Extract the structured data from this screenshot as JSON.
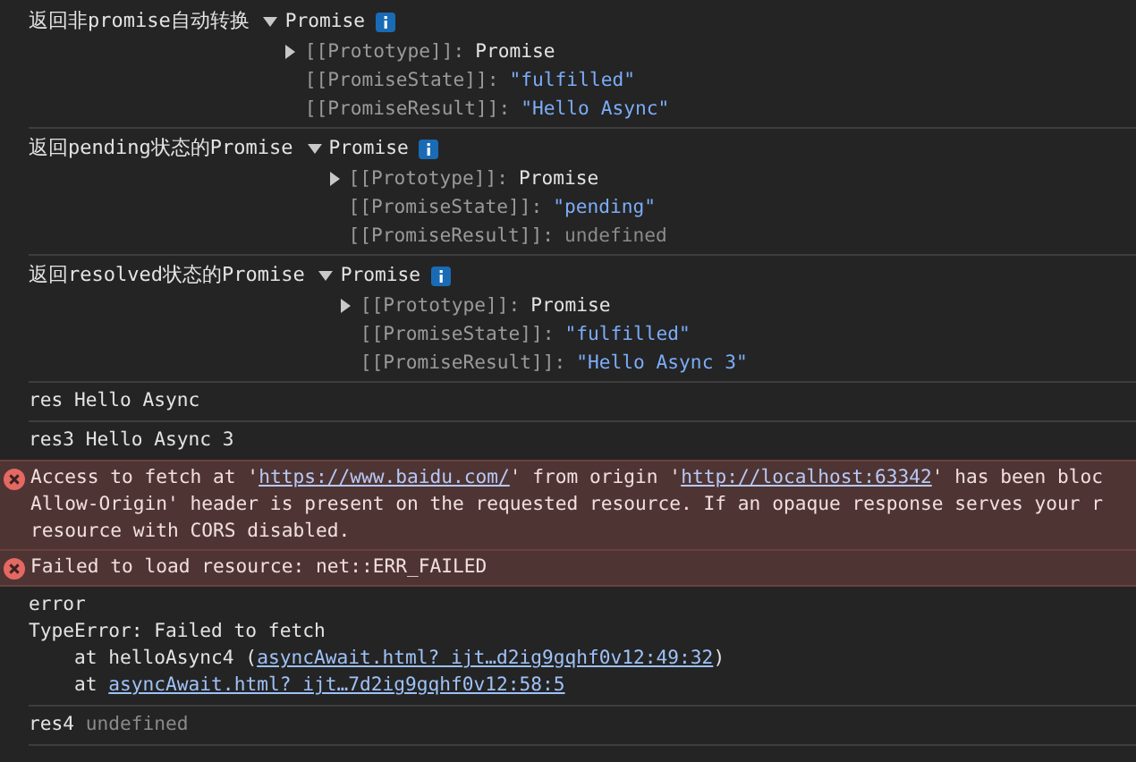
{
  "entries": [
    {
      "kind": "object",
      "label": "返回非promise自动转换",
      "summary": "Promise",
      "expanded": true,
      "properties": [
        {
          "key": "[[Prototype]]:",
          "value": "Promise",
          "kind": "object",
          "expanded": false
        },
        {
          "key": "[[PromiseState]]:",
          "value": "\"fulfilled\"",
          "kind": "string"
        },
        {
          "key": "[[PromiseResult]]:",
          "value": "\"Hello Async\"",
          "kind": "string"
        }
      ]
    },
    {
      "kind": "object",
      "label": "返回pending状态的Promise",
      "summary": "Promise",
      "expanded": true,
      "properties": [
        {
          "key": "[[Prototype]]:",
          "value": "Promise",
          "kind": "object",
          "expanded": false
        },
        {
          "key": "[[PromiseState]]:",
          "value": "\"pending\"",
          "kind": "string"
        },
        {
          "key": "[[PromiseResult]]:",
          "value": "undefined",
          "kind": "undefined"
        }
      ]
    },
    {
      "kind": "object",
      "label": "返回resolved状态的Promise",
      "summary": "Promise",
      "expanded": true,
      "properties": [
        {
          "key": "[[Prototype]]:",
          "value": "Promise",
          "kind": "object",
          "expanded": false
        },
        {
          "key": "[[PromiseState]]:",
          "value": "\"fulfilled\"",
          "kind": "string"
        },
        {
          "key": "[[PromiseResult]]:",
          "value": "\"Hello Async 3\"",
          "kind": "string"
        }
      ]
    },
    {
      "kind": "log",
      "lines": [
        [
          {
            "kind": "text",
            "text": "res Hello Async"
          }
        ]
      ]
    },
    {
      "kind": "log",
      "lines": [
        [
          {
            "kind": "text",
            "text": "res3 Hello Async 3"
          }
        ]
      ]
    },
    {
      "kind": "error",
      "lines": [
        [
          {
            "kind": "text",
            "text": "Access to fetch at '"
          },
          {
            "kind": "link",
            "text": "https://www.baidu.com/"
          },
          {
            "kind": "text",
            "text": "' from origin '"
          },
          {
            "kind": "link",
            "text": "http://localhost:63342"
          },
          {
            "kind": "text",
            "text": "' has been bloc"
          }
        ],
        [
          {
            "kind": "text",
            "text": "Allow-Origin' header is present on the requested resource. If an opaque response serves your r"
          }
        ],
        [
          {
            "kind": "text",
            "text": "resource with CORS disabled."
          }
        ]
      ]
    },
    {
      "kind": "error",
      "lines": [
        [
          {
            "kind": "text",
            "text": "Failed to load resource: net::ERR_FAILED"
          }
        ]
      ]
    },
    {
      "kind": "log",
      "lines": [
        [
          {
            "kind": "text",
            "text": "error"
          }
        ],
        [
          {
            "kind": "text",
            "text": "TypeError: Failed to fetch"
          }
        ],
        [
          {
            "kind": "text",
            "text": "    at helloAsync4 ("
          },
          {
            "kind": "link",
            "text": "asyncAwait.html? ijt…d2ig9gqhf0v12:49:32"
          },
          {
            "kind": "text",
            "text": ")"
          }
        ],
        [
          {
            "kind": "text",
            "text": "    at "
          },
          {
            "kind": "link",
            "text": "asyncAwait.html? ijt…7d2ig9gqhf0v12:58:5"
          }
        ]
      ]
    },
    {
      "kind": "log",
      "lines": [
        [
          {
            "kind": "text",
            "text": "res4 "
          },
          {
            "kind": "dim",
            "text": "undefined"
          }
        ]
      ]
    }
  ]
}
